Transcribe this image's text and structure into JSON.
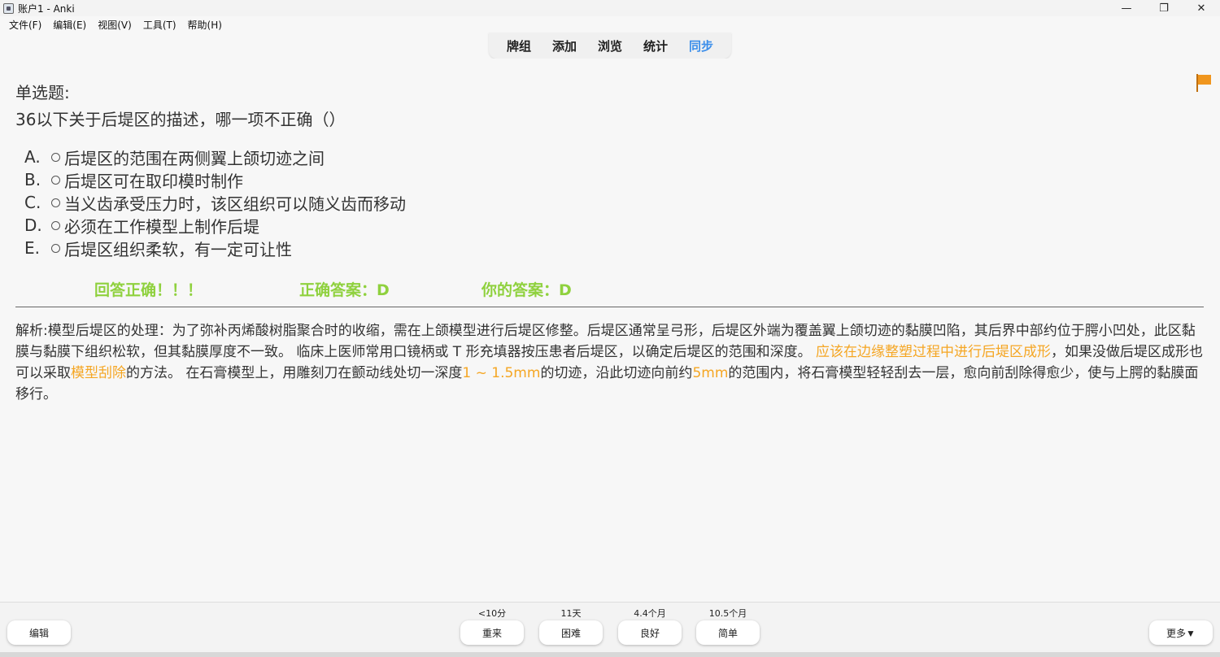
{
  "window": {
    "title": "账户1 - Anki",
    "min": "—",
    "restore": "❐",
    "close": "✕"
  },
  "menu": [
    "文件(F)",
    "编辑(E)",
    "视图(V)",
    "工具(T)",
    "帮助(H)"
  ],
  "toolbar": {
    "decks": "牌组",
    "add": "添加",
    "browse": "浏览",
    "stats": "统计",
    "sync": "同步"
  },
  "colors": {
    "sync_accent": "#3b8eea",
    "correct_green": "#8fd13e",
    "highlight_orange": "#f5a623",
    "flag_orange": "#f0961e"
  },
  "card": {
    "type_label": "单选题:",
    "question": "36以下关于后堤区的描述，哪一项不正确（）",
    "options": [
      {
        "letter": "A.",
        "text": "后堤区的范围在两侧翼上颌切迹之间"
      },
      {
        "letter": "B.",
        "text": "后堤区可在取印模时制作"
      },
      {
        "letter": "C.",
        "text": "当义齿承受压力时，该区组织可以随义齿而移动"
      },
      {
        "letter": "D.",
        "text": "必须在工作模型上制作后堤"
      },
      {
        "letter": "E.",
        "text": "后堤区组织柔软，有一定可让性"
      }
    ],
    "result": {
      "verdict": "回答正确！！！",
      "correct_answer": "正确答案：D",
      "your_answer": "你的答案：D"
    },
    "explanation": {
      "p1": "解析:模型后堤区的处理：为了弥补丙烯酸树脂聚合时的收缩，需在上颌模型进行后堤区修整。后堤区通常呈弓形，后堤区外端为覆盖翼上颌切迹的黏膜凹陷，其后界中部约位于腭小凹处，此区黏膜与黏膜下组织松软，但其黏膜厚度不一致。 临床上医师常用口镜柄或 T 形充填器按压患者后堤区，以确定后堤区的范围和深度。 ",
      "h1": "应该在边缘整塑过程中进行后堤区成形",
      "p2": "，如果没做后堤区成形也可以采取",
      "h2": "模型刮除",
      "p3": "的方法。 在石膏模型上，用雕刻刀在颤动线处切一深度",
      "h3": "1 ~ 1.5mm",
      "p4": "的切迹，沿此切迹向前约",
      "h4": "5mm",
      "p5": "的范围内，将石膏模型轻轻刮去一层，愈向前刮除得愈少，使与上腭的黏膜面移行。"
    }
  },
  "bottom": {
    "edit": "编辑",
    "more": "更多▼",
    "answers": [
      {
        "due": "<10分",
        "label": "重来"
      },
      {
        "due": "11天",
        "label": "困难"
      },
      {
        "due": "4.4个月",
        "label": "良好"
      },
      {
        "due": "10.5个月",
        "label": "简单"
      }
    ]
  }
}
